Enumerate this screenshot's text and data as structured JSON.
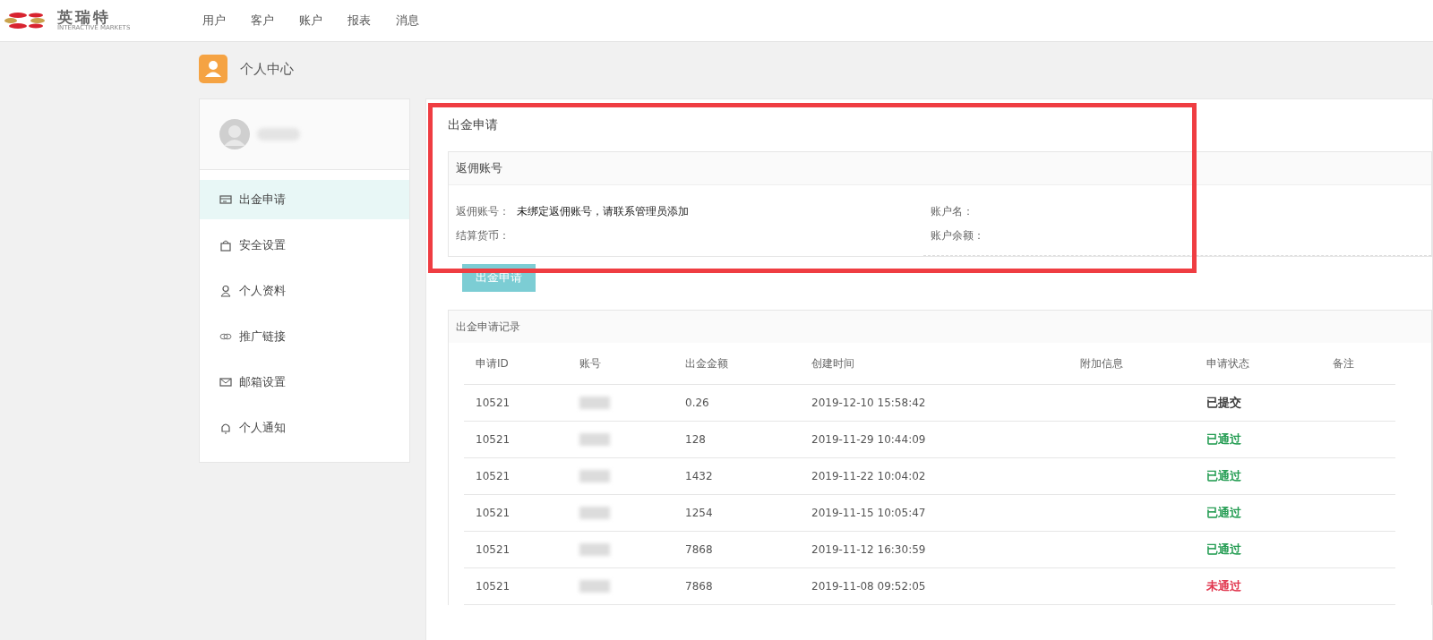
{
  "brand": {
    "name": "英瑞特",
    "tagline": "INTERACTIVE MARKETS"
  },
  "nav": [
    {
      "label": "用户"
    },
    {
      "label": "客户"
    },
    {
      "label": "账户"
    },
    {
      "label": "报表"
    },
    {
      "label": "消息"
    }
  ],
  "page_title": "个人中心",
  "sidebar": {
    "items": [
      {
        "label": "出金申请",
        "kind": "card",
        "selected": true
      },
      {
        "label": "安全设置",
        "kind": "lock",
        "selected": false
      },
      {
        "label": "个人资料",
        "kind": "person",
        "selected": false
      },
      {
        "label": "推广链接",
        "kind": "link",
        "selected": false
      },
      {
        "label": "邮箱设置",
        "kind": "mail",
        "selected": false
      },
      {
        "label": "个人通知",
        "kind": "bell",
        "selected": false
      }
    ]
  },
  "panel_title": "出金申请",
  "rebate_box": {
    "title": "返佣账号",
    "fields": [
      {
        "label": "返佣账号：",
        "value": "未绑定返佣账号，请联系管理员添加"
      },
      {
        "label": "账户名："
      },
      {
        "label": "结算货币："
      },
      {
        "label": "账户余额："
      }
    ]
  },
  "submit_button": "出金申请",
  "records": {
    "title": "出金申请记录",
    "columns": [
      "申请ID",
      "账号",
      "出金金额",
      "创建时间",
      "附加信息",
      "申请状态",
      "备注"
    ],
    "rows": [
      {
        "id": "10521",
        "amount": "0.26",
        "created": "2019-12-10 15:58:42",
        "status": "已提交",
        "color": "#333333"
      },
      {
        "id": "10521",
        "amount": "128",
        "created": "2019-11-29 10:44:09",
        "status": "已通过",
        "color": "#1e9a4e"
      },
      {
        "id": "10521",
        "amount": "1432",
        "created": "2019-11-22 10:04:02",
        "status": "已通过",
        "color": "#1e9a4e"
      },
      {
        "id": "10521",
        "amount": "1254",
        "created": "2019-11-15 10:05:47",
        "status": "已通过",
        "color": "#1e9a4e"
      },
      {
        "id": "10521",
        "amount": "7868",
        "created": "2019-11-12 16:30:59",
        "status": "已通过",
        "color": "#1e9a4e"
      },
      {
        "id": "10521",
        "amount": "7868",
        "created": "2019-11-08 09:52:05",
        "status": "未通过",
        "color": "#e0324a"
      }
    ]
  }
}
